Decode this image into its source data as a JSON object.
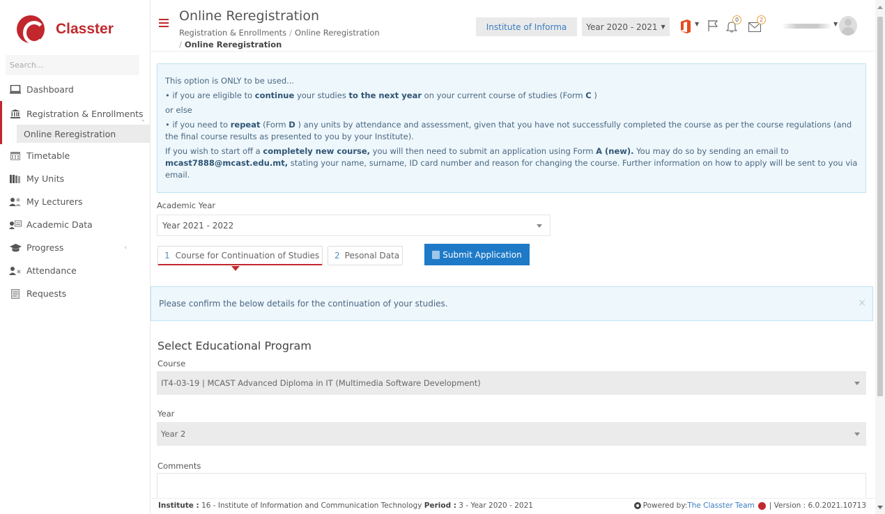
{
  "app": {
    "logo_text": "Classter",
    "search_placeholder": "Search..."
  },
  "sidebar": {
    "items": [
      {
        "label": "Dashboard",
        "icon": "monitor-icon"
      },
      {
        "label": "Registration & Enrollments",
        "icon": "institution-icon"
      },
      {
        "label": "Timetable",
        "icon": "calendar-icon"
      },
      {
        "label": "My Units",
        "icon": "books-icon"
      },
      {
        "label": "My Lecturers",
        "icon": "users-icon"
      },
      {
        "label": "Academic Data",
        "icon": "user-card-icon"
      },
      {
        "label": "Progress",
        "icon": "graduation-cap-icon"
      },
      {
        "label": "Attendance",
        "icon": "user-x-icon"
      },
      {
        "label": "Requests",
        "icon": "document-icon"
      }
    ],
    "sub_item": "Online Reregistration"
  },
  "header": {
    "title": "Online Reregistration",
    "breadcrumb": [
      "Registration & Enrollments",
      "Online Reregistration",
      "Online Reregistration"
    ],
    "institute_button": "Institute of Informa",
    "year_selector": "Year 2020 - 2021",
    "bell_count": "0",
    "mail_count": "2",
    "accent_color": "#c1272d"
  },
  "info": {
    "line1": "This option is ONLY to be used...",
    "line2_a": "• if you are eligible to ",
    "line2_b": "continue",
    "line2_c": "  your studies ",
    "line2_d": "to the next year",
    "line2_e": "  on your current course of studies (Form ",
    "line2_f": "C",
    "line2_g": " )",
    "line3": "or else",
    "line4_a": "• if you need to ",
    "line4_b": "repeat",
    "line4_c": "  (Form ",
    "line4_d": "D",
    "line4_e": " ) any units by attendance and assessment, given that you have not successfully completed the course as per the course regulations (and the final course results as presented to you by your Institute).",
    "line5_a": "If you wish to start off a ",
    "line5_b": "completely new course,",
    "line5_c": "  you will then need to submit an application using Form ",
    "line5_d": "A (new).",
    "line5_e": "  You may do so by sending an email to ",
    "line5_f": "mcast7888@mcast.edu.mt,",
    "line5_g": "  stating your name, surname, ID card number and reason for changing the course. Further information on how to apply will be sent to you via email."
  },
  "form": {
    "academic_year_label": "Academic Year",
    "academic_year_value": "Year 2021 - 2022",
    "step1_num": "1",
    "step1_label": "Course for Continuation of Studies",
    "step2_num": "2",
    "step2_label": "Pesonal Data",
    "submit_label": "Submit Application",
    "confirm_text": "Please confirm the below details for the continuation of your studies.",
    "close_glyph": "×",
    "section_title": "Select Educational Program",
    "course_label": "Course",
    "course_value": "IT4-03-19 | MCAST Advanced Diploma in IT (Multimedia Software Development)",
    "year_label": "Year",
    "year_value": "Year 2",
    "comments_label": "Comments"
  },
  "footer": {
    "institute_label": "Institute :",
    "institute_value": " 16 - Institute of Information and Communication Technology ",
    "period_label": "Period :",
    "period_value": " 3 - Year 2020 - 2021",
    "powered_prefix": "Powered by: ",
    "powered_link": "The Classter Team",
    "version": "| Version : 6.0.2021.10713"
  }
}
